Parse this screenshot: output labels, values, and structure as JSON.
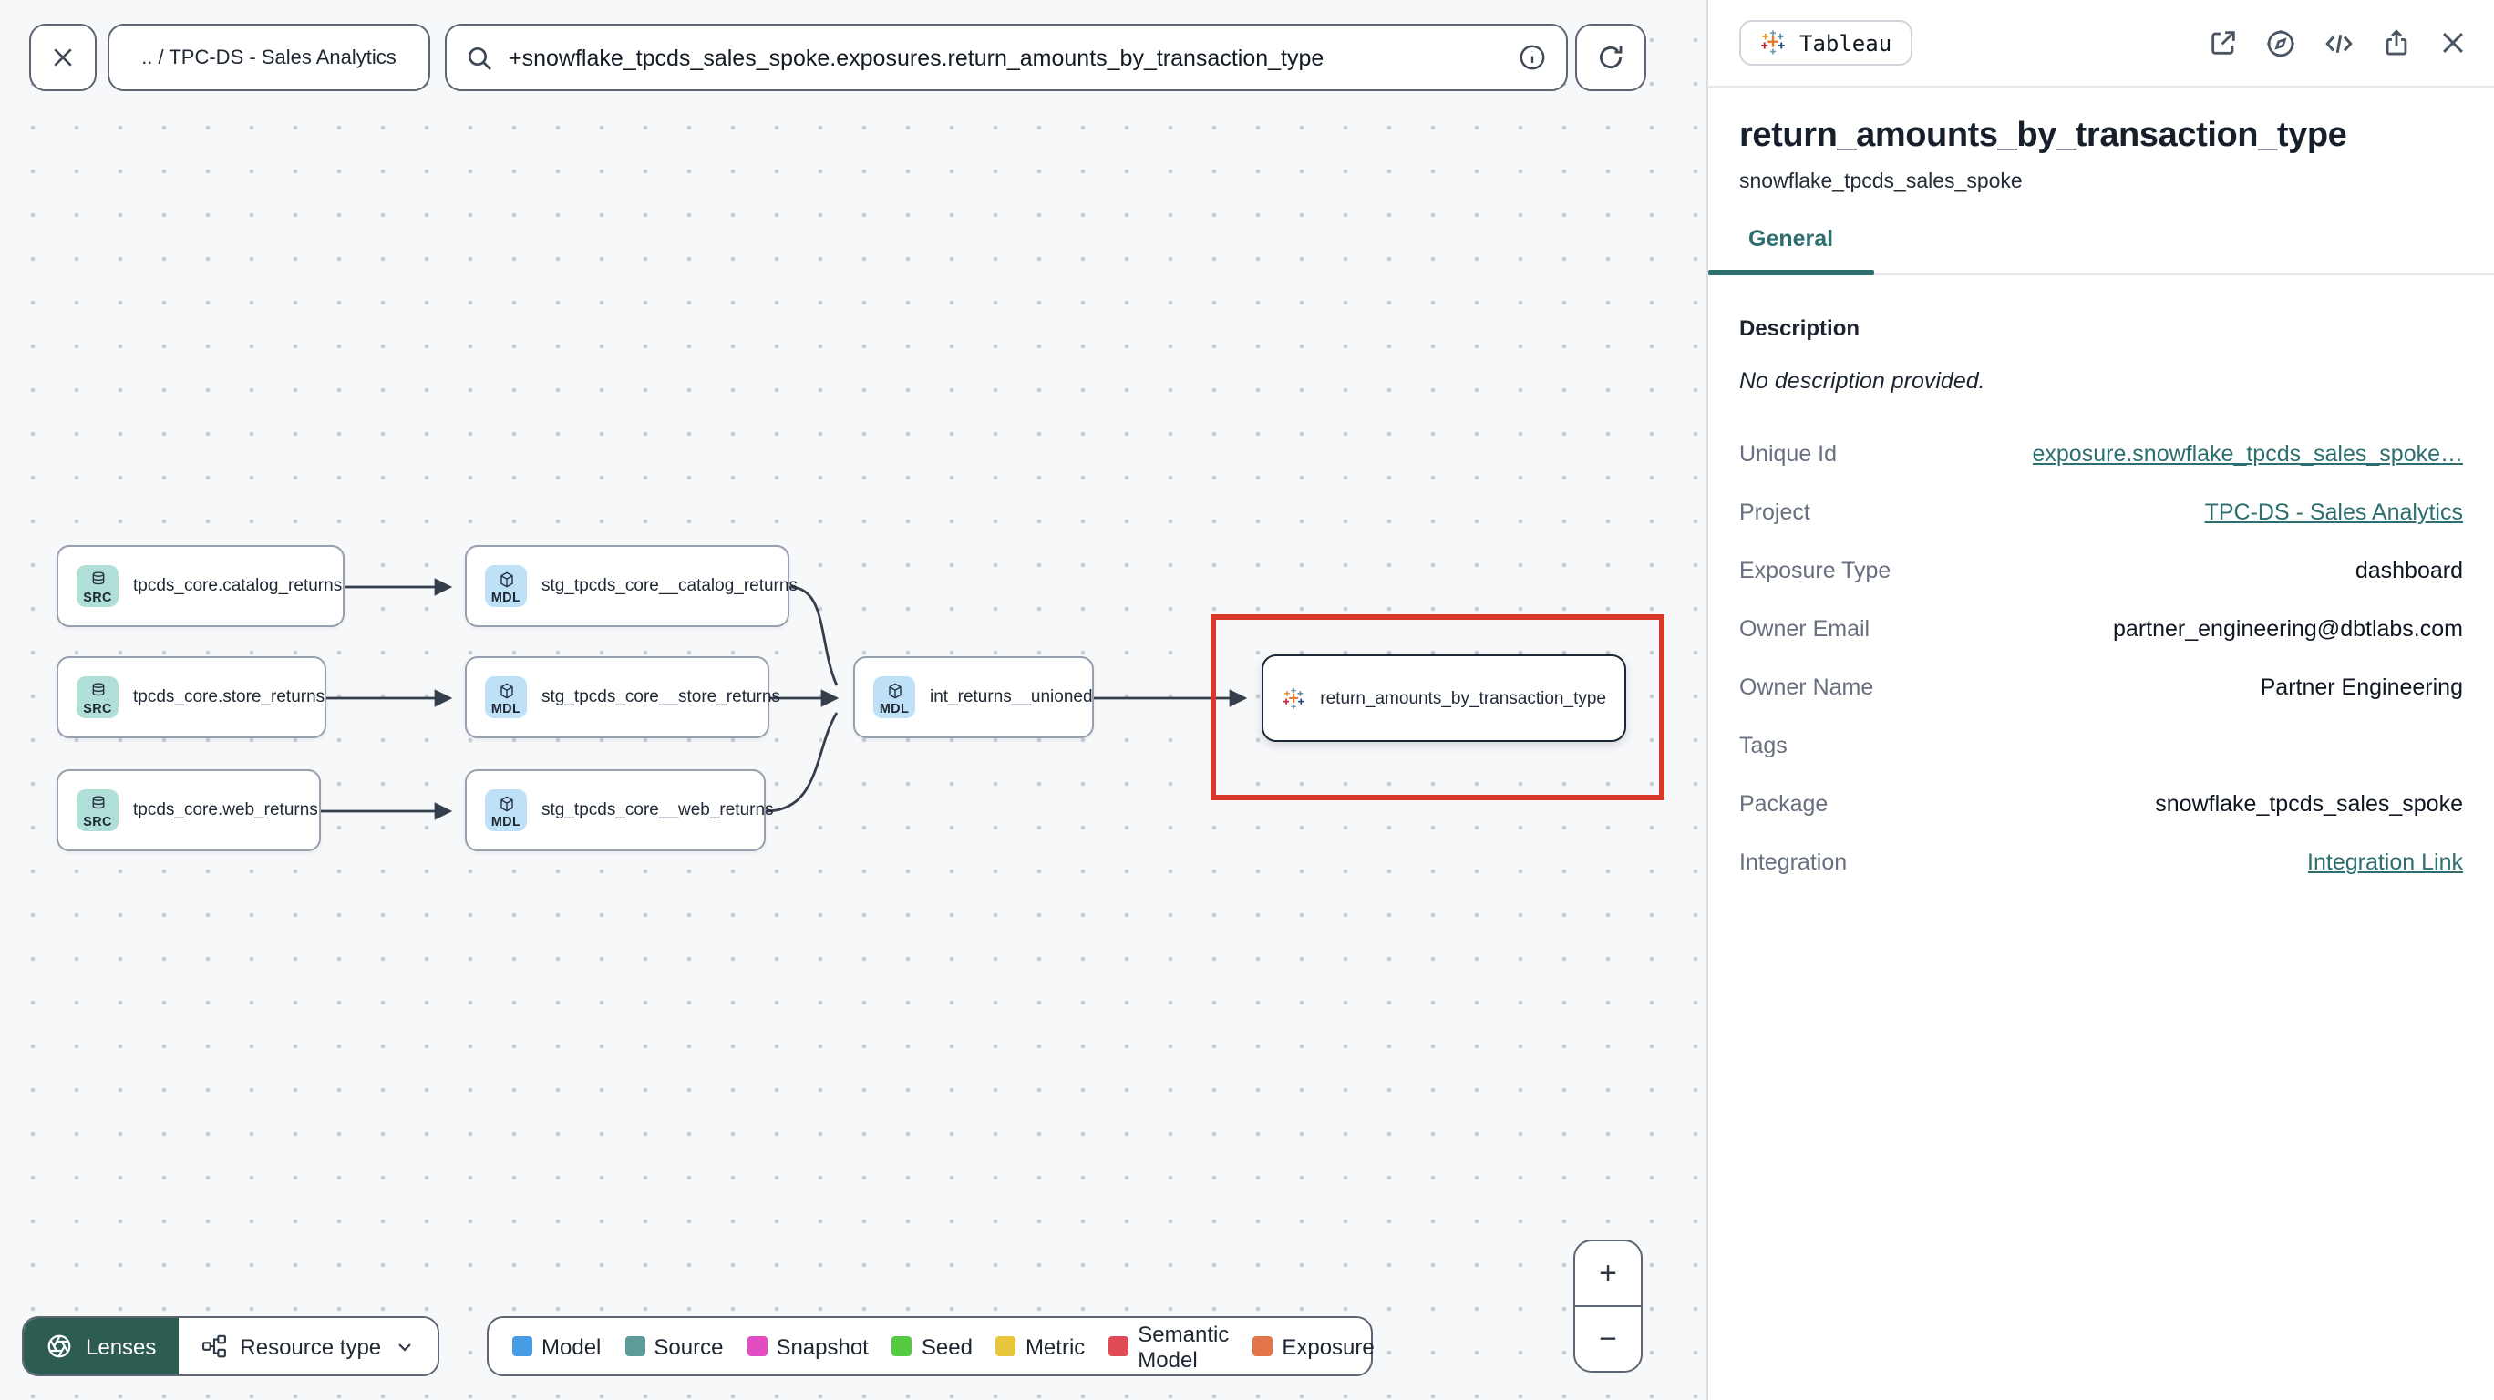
{
  "toolbar": {
    "breadcrumb": ".. / TPC-DS - Sales Analytics",
    "search_query": "+snowflake_tpcds_sales_spoke.exposures.return_amounts_by_transaction_type"
  },
  "graph": {
    "nodes": [
      {
        "type": "source",
        "badge": "SRC",
        "label": "tpcds_core.catalog_returns"
      },
      {
        "type": "source",
        "badge": "SRC",
        "label": "tpcds_core.store_returns"
      },
      {
        "type": "source",
        "badge": "SRC",
        "label": "tpcds_core.web_returns"
      },
      {
        "type": "model",
        "badge": "MDL",
        "label": "stg_tpcds_core__catalog_returns"
      },
      {
        "type": "model",
        "badge": "MDL",
        "label": "stg_tpcds_core__store_returns"
      },
      {
        "type": "model",
        "badge": "MDL",
        "label": "stg_tpcds_core__web_returns"
      },
      {
        "type": "model",
        "badge": "MDL",
        "label": "int_returns__unioned"
      },
      {
        "type": "exposure",
        "badge": "",
        "label": "return_amounts_by_transaction_type"
      }
    ],
    "lenses_label": "Lenses",
    "resource_type_label": "Resource type",
    "zoom_in": "+",
    "zoom_out": "−",
    "legend": [
      {
        "label": "Model",
        "color": "#479ce4"
      },
      {
        "label": "Source",
        "color": "#5d9b9b"
      },
      {
        "label": "Snapshot",
        "color": "#e24ec2"
      },
      {
        "label": "Seed",
        "color": "#56c943"
      },
      {
        "label": "Metric",
        "color": "#e7c53d"
      },
      {
        "label": "Semantic Model",
        "color": "#df4a54"
      },
      {
        "label": "Exposure",
        "color": "#e2764a"
      }
    ],
    "highlight_color": "#d6392b"
  },
  "panel": {
    "source_badge": "Tableau",
    "title": "return_amounts_by_transaction_type",
    "subtitle": "snowflake_tpcds_sales_spoke",
    "tab": "General",
    "description_heading": "Description",
    "description_empty": "No description provided.",
    "accent_color": "#2d6e6e",
    "fields": [
      {
        "label": "Unique Id",
        "value": "exposure.snowflake_tpcds_sales_spoke…",
        "type": "link"
      },
      {
        "label": "Project",
        "value": "TPC-DS - Sales Analytics",
        "type": "link"
      },
      {
        "label": "Exposure Type",
        "value": "dashboard",
        "type": "text"
      },
      {
        "label": "Owner Email",
        "value": "partner_engineering@dbtlabs.com",
        "type": "text"
      },
      {
        "label": "Owner Name",
        "value": "Partner Engineering",
        "type": "text"
      },
      {
        "label": "Tags",
        "value": "",
        "type": "text"
      },
      {
        "label": "Package",
        "value": "snowflake_tpcds_sales_spoke",
        "type": "text"
      },
      {
        "label": "Integration",
        "value": "Integration Link",
        "type": "link"
      }
    ]
  }
}
